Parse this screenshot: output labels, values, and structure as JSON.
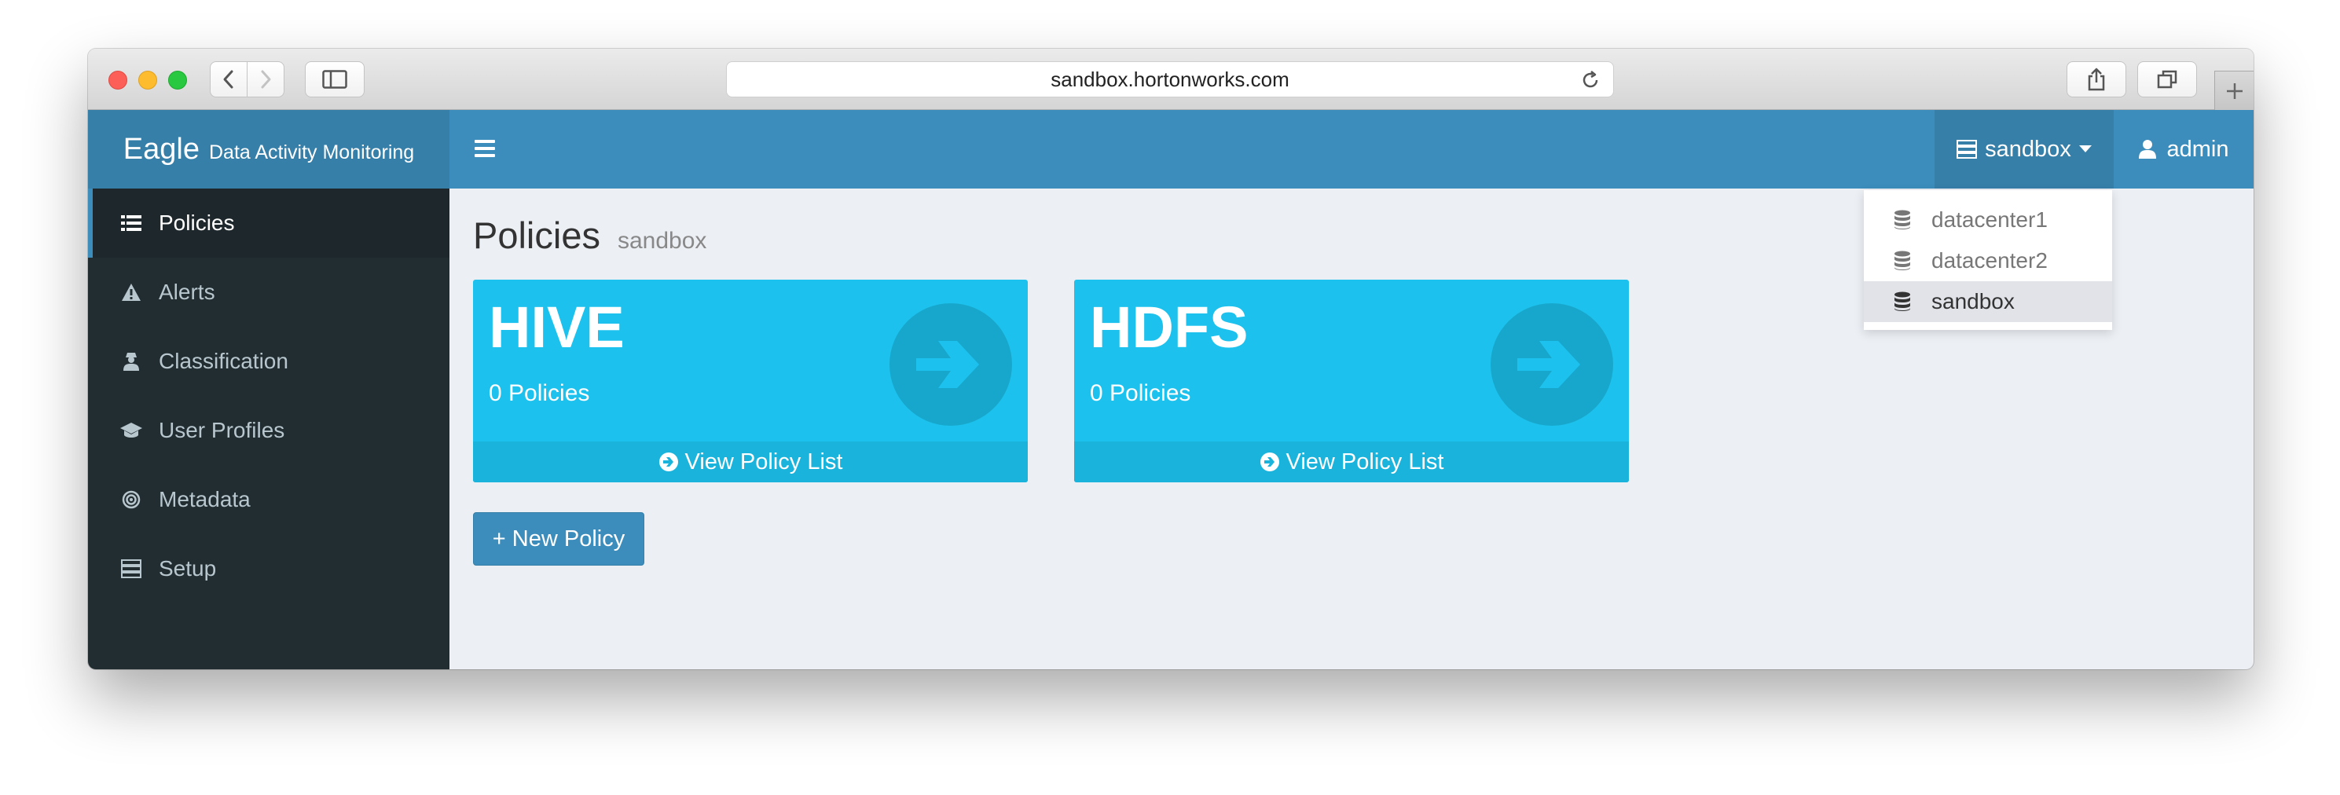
{
  "browser": {
    "url": "sandbox.hortonworks.com"
  },
  "header": {
    "brand_name": "Eagle",
    "brand_subtitle": "Data Activity Monitoring",
    "site_label": "sandbox",
    "user_label": "admin"
  },
  "sidebar": {
    "items": [
      {
        "label": "Policies",
        "icon": "list-icon"
      },
      {
        "label": "Alerts",
        "icon": "warning-icon"
      },
      {
        "label": "Classification",
        "icon": "user-secret-icon"
      },
      {
        "label": "User Profiles",
        "icon": "graduation-cap-icon"
      },
      {
        "label": "Metadata",
        "icon": "bullseye-icon"
      },
      {
        "label": "Setup",
        "icon": "server-icon"
      }
    ]
  },
  "main": {
    "title": "Policies",
    "subtitle": "sandbox",
    "boxes": [
      {
        "name": "HIVE",
        "count": "0 Policies",
        "link": "View Policy List"
      },
      {
        "name": "HDFS",
        "count": "0 Policies",
        "link": "View Policy List"
      }
    ],
    "new_policy_label": "+ New Policy"
  },
  "dropdown": {
    "items": [
      {
        "label": "datacenter1",
        "icon": "database-icon"
      },
      {
        "label": "datacenter2",
        "icon": "database-icon"
      },
      {
        "label": "sandbox",
        "icon": "database-icon",
        "selected": true
      }
    ]
  },
  "colors": {
    "header": "#3c8dbc",
    "brand": "#367fa9",
    "sidebar": "#222d32",
    "box": "#1cc2ed",
    "content_bg": "#ecf0f5"
  }
}
